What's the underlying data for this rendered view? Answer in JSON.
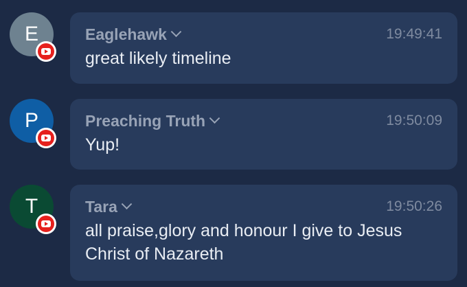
{
  "messages": [
    {
      "avatar_letter": "E",
      "avatar_color": "#6e8290",
      "author": "Eaglehawk",
      "time": "19:49:41",
      "text": "great likely timeline"
    },
    {
      "avatar_letter": "P",
      "avatar_color": "#0f5ea5",
      "author": "Preaching Truth",
      "time": "19:50:09",
      "text": "Yup!"
    },
    {
      "avatar_letter": "T",
      "avatar_color": "#0a4a33",
      "author": "Tara",
      "time": "19:50:26",
      "text": "all praise,glory and honour I give to Jesus Christ of Nazareth"
    }
  ],
  "platform_icon": "youtube-icon",
  "colors": {
    "background": "#1c2a45",
    "bubble": "#283b5c",
    "author_text": "#98a3b6",
    "time_text": "#7f8ba0",
    "message_text": "#e9edf3",
    "badge_red": "#e6201d"
  }
}
